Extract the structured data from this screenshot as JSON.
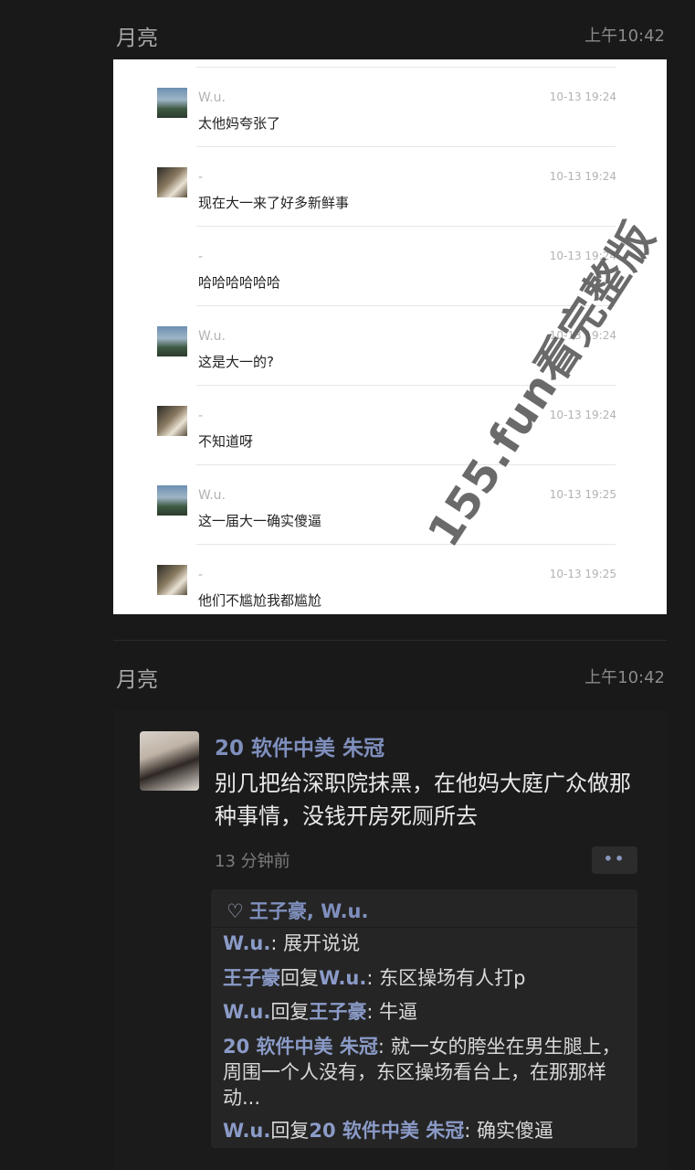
{
  "message1": {
    "sender": "月亮",
    "time": "上午10:42"
  },
  "screenshot": {
    "rows": [
      {
        "avatar": "landscape-avatar",
        "name": "W.u.",
        "time": "10-13 19:24",
        "text": "太他妈夸张了"
      },
      {
        "avatar": "room-avatar",
        "name": "-",
        "time": "10-13 19:24",
        "text": "现在大一来了好多新鲜事"
      },
      {
        "avatar": "none",
        "name": "-",
        "time": "10-13 19:24",
        "text": "哈哈哈哈哈哈"
      },
      {
        "avatar": "landscape-avatar",
        "name": "W.u.",
        "time": "10-13 19:24",
        "text": "这是大一的?"
      },
      {
        "avatar": "room-avatar",
        "name": "-",
        "time": "10-13 19:24",
        "text": "不知道呀"
      },
      {
        "avatar": "landscape-avatar",
        "name": "W.u.",
        "time": "10-13 19:25",
        "text": "这一届大一确实傻逼"
      },
      {
        "avatar": "room-avatar",
        "name": "-",
        "time": "10-13 19:25",
        "text": "他们不尴尬我都尴尬"
      }
    ],
    "watermark": "155.fun看完整版"
  },
  "message2": {
    "sender": "月亮",
    "time": "上午10:42"
  },
  "moment": {
    "author": "20 软件中美 朱冠",
    "text": "别几把给深职院抹黑，在他妈大庭广众做那种事情，没钱开房死厕所去",
    "time": "13 分钟前",
    "more_icon": "••",
    "likes": "王子豪, W.u.",
    "comments": [
      {
        "name": "W.u.",
        "reply_word": "",
        "reply_to": "",
        "text": ": 展开说说"
      },
      {
        "name": "王子豪",
        "reply_word": "回复",
        "reply_to": "W.u.",
        "text": ": 东区操场有人打p"
      },
      {
        "name": "W.u.",
        "reply_word": "回复",
        "reply_to": "王子豪",
        "text": ": 牛逼"
      },
      {
        "name": "20 软件中美 朱冠",
        "reply_word": "",
        "reply_to": "",
        "text": ": 就一女的胯坐在男生腿上，周围一个人没有，东区操场看台上，在那那样动..."
      },
      {
        "name": "W.u.",
        "reply_word": "回复",
        "reply_to": "20 软件中美 朱冠",
        "text": ": 确实傻逼"
      }
    ]
  },
  "colors": {
    "background": "#191919",
    "link_name": "#8b9bc8",
    "card": "#ffffff"
  }
}
